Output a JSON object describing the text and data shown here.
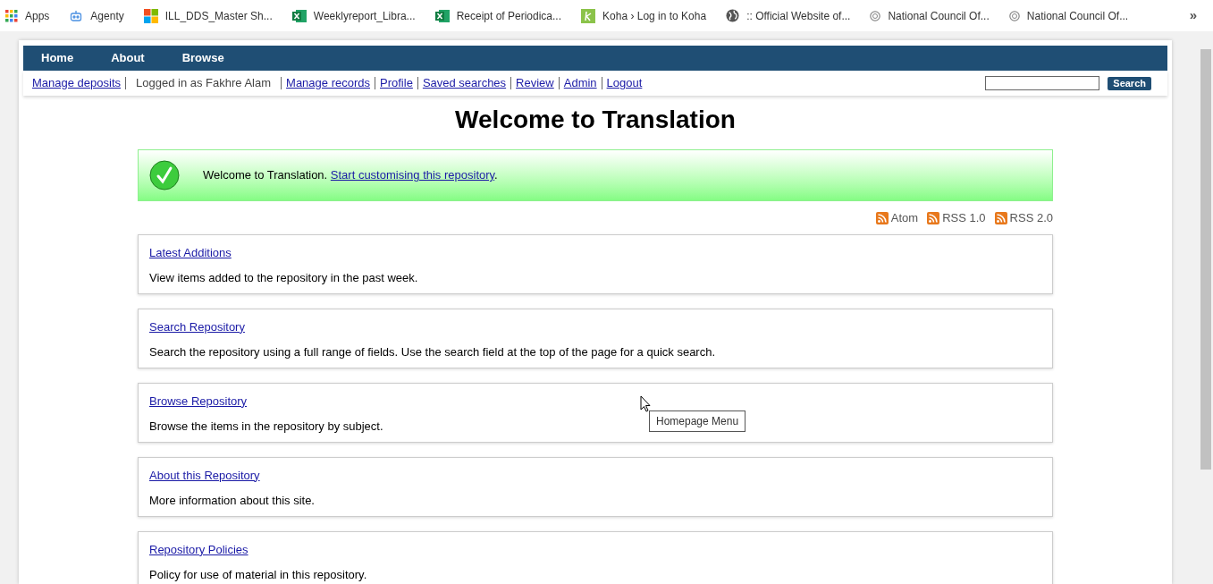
{
  "bookmarks": [
    {
      "label": "Apps",
      "kind": "grid"
    },
    {
      "label": "Agenty",
      "kind": "robot"
    },
    {
      "label": "ILL_DDS_Master Sh...",
      "kind": "windows"
    },
    {
      "label": "Weeklyreport_Libra...",
      "kind": "sheet"
    },
    {
      "label": "Receipt of Periodica...",
      "kind": "sheet"
    },
    {
      "label": "Koha › Log in to Koha",
      "kind": "koha"
    },
    {
      "label": ":: Official Website of...",
      "kind": "globe"
    },
    {
      "label": "National Council Of...",
      "kind": "seal"
    },
    {
      "label": "National Council Of...",
      "kind": "seal"
    }
  ],
  "bookmarks_more": "»",
  "nav": [
    "Home",
    "About",
    "Browse"
  ],
  "user_links": [
    {
      "label": "Manage deposits",
      "kind": "link"
    },
    {
      "label": "Logged in as Fakhre Alam",
      "kind": "text"
    },
    {
      "label": "Manage records",
      "kind": "link"
    },
    {
      "label": "Profile",
      "kind": "link"
    },
    {
      "label": "Saved searches",
      "kind": "link"
    },
    {
      "label": "Review",
      "kind": "link"
    },
    {
      "label": "Admin",
      "kind": "link"
    },
    {
      "label": "Logout",
      "kind": "link"
    }
  ],
  "search": {
    "button": "Search"
  },
  "title": "Welcome to Translation",
  "message": {
    "text": "Welcome to Translation. ",
    "link": "Start customising this repository",
    "after": "."
  },
  "feeds": [
    "Atom",
    "RSS 1.0",
    "RSS 2.0"
  ],
  "menu": [
    {
      "link": "Latest Additions",
      "text": "View items added to the repository in the past week."
    },
    {
      "link": "Search Repository",
      "text": "Search the repository using a full range of fields. Use the search field at the top of the page for a quick search."
    },
    {
      "link": "Browse Repository",
      "text": "Browse the items in the repository by subject."
    },
    {
      "link": "About this Repository",
      "text": "More information about this site."
    },
    {
      "link": "Repository Policies",
      "text": "Policy for use of material in this repository."
    }
  ],
  "tooltip": "Homepage Menu"
}
